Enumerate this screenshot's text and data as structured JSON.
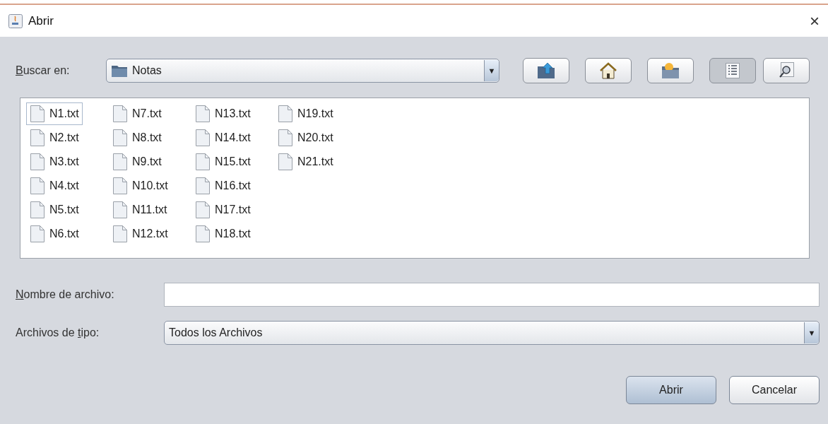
{
  "window": {
    "title": "Abrir",
    "close": "×"
  },
  "look_in": {
    "label": {
      "key": "B",
      "after": "uscar en:"
    },
    "value": "Notas",
    "arrow": "▼"
  },
  "toolbar": [
    {
      "kind": "up",
      "selected": false
    },
    {
      "kind": "home",
      "selected": false
    },
    {
      "kind": "newfolder",
      "selected": false
    },
    {
      "kind": "list",
      "selected": true
    },
    {
      "kind": "details",
      "selected": false
    }
  ],
  "files": [
    {
      "name": "N1.txt",
      "focused": true
    },
    {
      "name": "N2.txt",
      "focused": false
    },
    {
      "name": "N3.txt",
      "focused": false
    },
    {
      "name": "N4.txt",
      "focused": false
    },
    {
      "name": "N5.txt",
      "focused": false
    },
    {
      "name": "N6.txt",
      "focused": false
    },
    {
      "name": "N7.txt",
      "focused": false
    },
    {
      "name": "N8.txt",
      "focused": false
    },
    {
      "name": "N9.txt",
      "focused": false
    },
    {
      "name": "N10.txt",
      "focused": false
    },
    {
      "name": "N11.txt",
      "focused": false
    },
    {
      "name": "N12.txt",
      "focused": false
    },
    {
      "name": "N13.txt",
      "focused": false
    },
    {
      "name": "N14.txt",
      "focused": false
    },
    {
      "name": "N15.txt",
      "focused": false
    },
    {
      "name": "N16.txt",
      "focused": false
    },
    {
      "name": "N17.txt",
      "focused": false
    },
    {
      "name": "N18.txt",
      "focused": false
    },
    {
      "name": "N19.txt",
      "focused": false
    },
    {
      "name": "N20.txt",
      "focused": false
    },
    {
      "name": "N21.txt",
      "focused": false
    }
  ],
  "file_name": {
    "label": {
      "key": "N",
      "after": "ombre de archivo:"
    }
  },
  "file_type": {
    "label": {
      "before": "Archivos de ",
      "key": "t",
      "after": "ipo:"
    },
    "value": "Todos los Archivos",
    "arrow": "▼"
  },
  "buttons": [
    {
      "label": "Abrir",
      "kind": "default"
    },
    {
      "label": "Cancelar",
      "kind": "normal"
    }
  ]
}
